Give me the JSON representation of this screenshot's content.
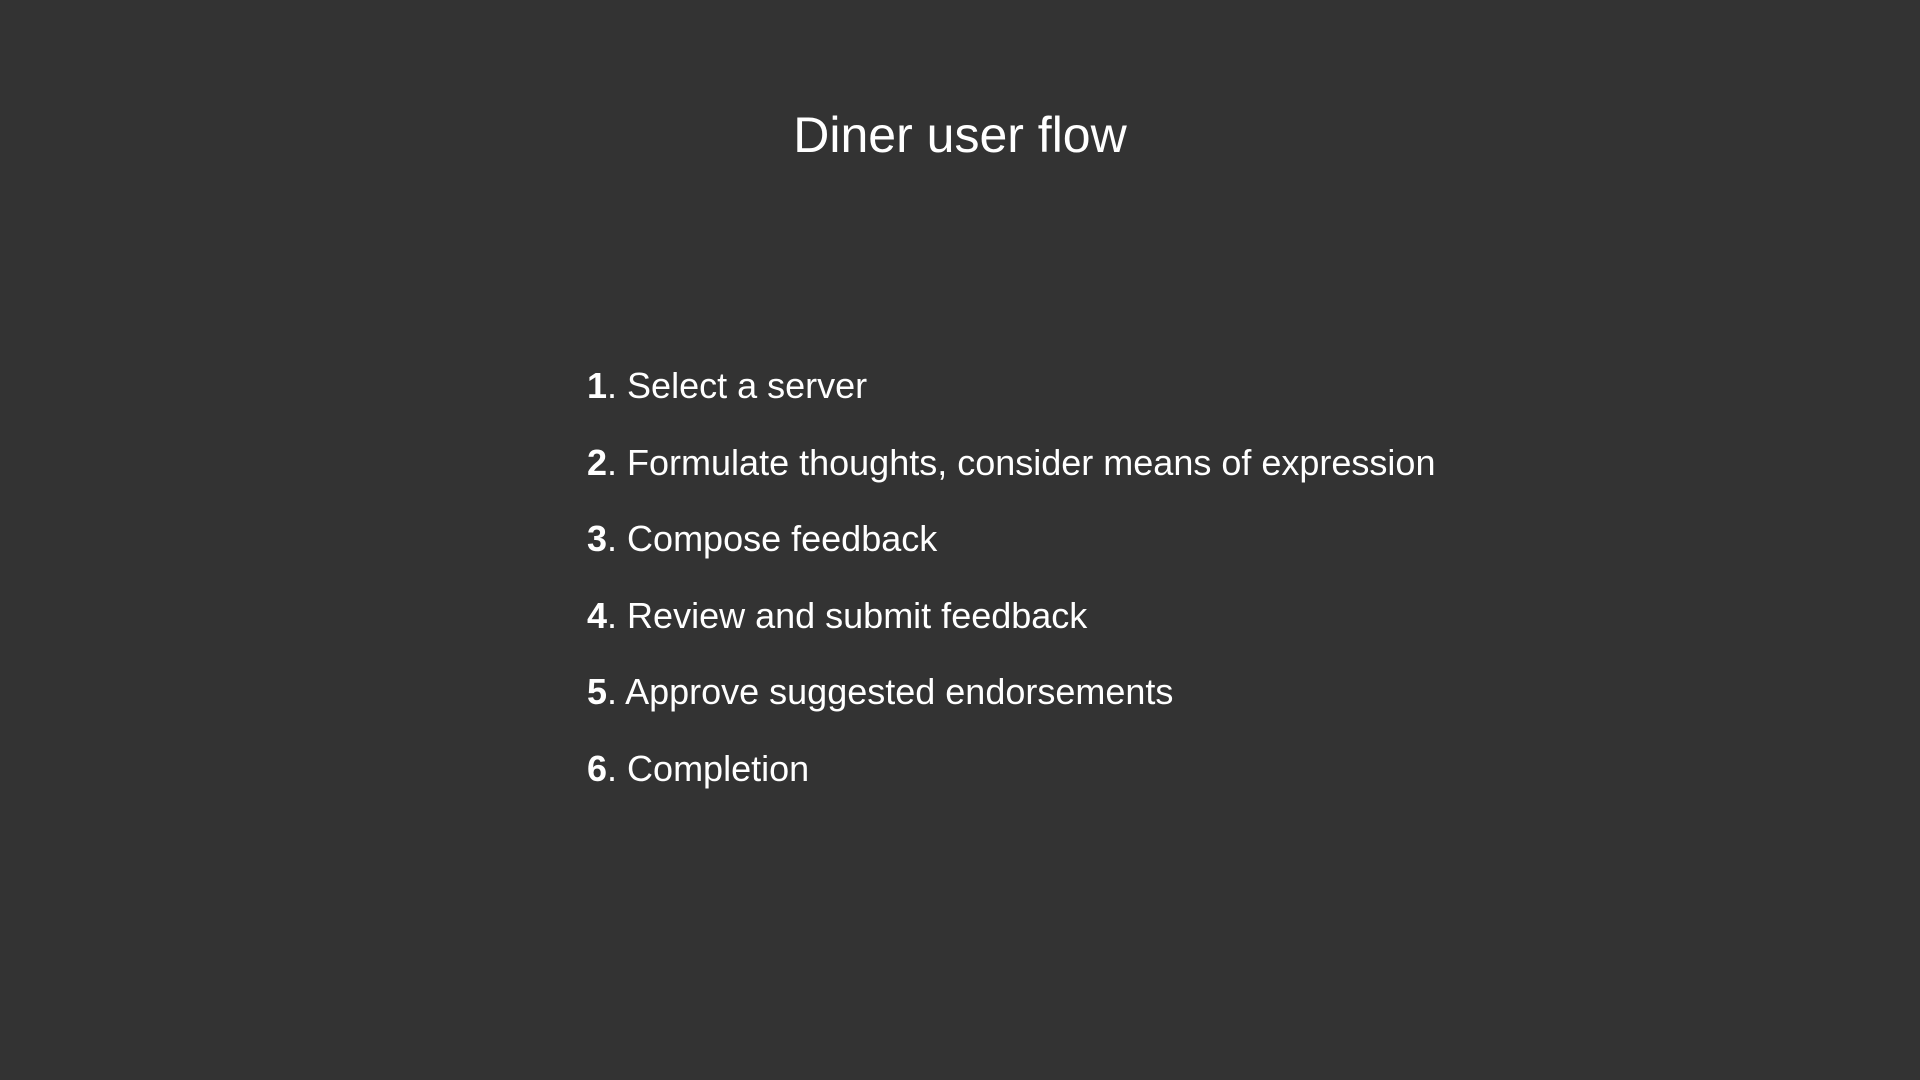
{
  "slide": {
    "title": "Diner user flow",
    "background_color": "#333333",
    "text_color": "#ffffff",
    "steps": [
      {
        "number": "1",
        "separator": ". ",
        "text": "Select a server"
      },
      {
        "number": "2",
        "separator": ". ",
        "text": "Formulate thoughts, consider means of expression"
      },
      {
        "number": "3",
        "separator": ". ",
        "text": "Compose feedback"
      },
      {
        "number": "4",
        "separator": ". ",
        "text": "Review and submit feedback"
      },
      {
        "number": "5",
        "separator": ". ",
        "text": "Approve suggested endorsements"
      },
      {
        "number": "6",
        "separator": ". ",
        "text": "Completion"
      }
    ]
  }
}
